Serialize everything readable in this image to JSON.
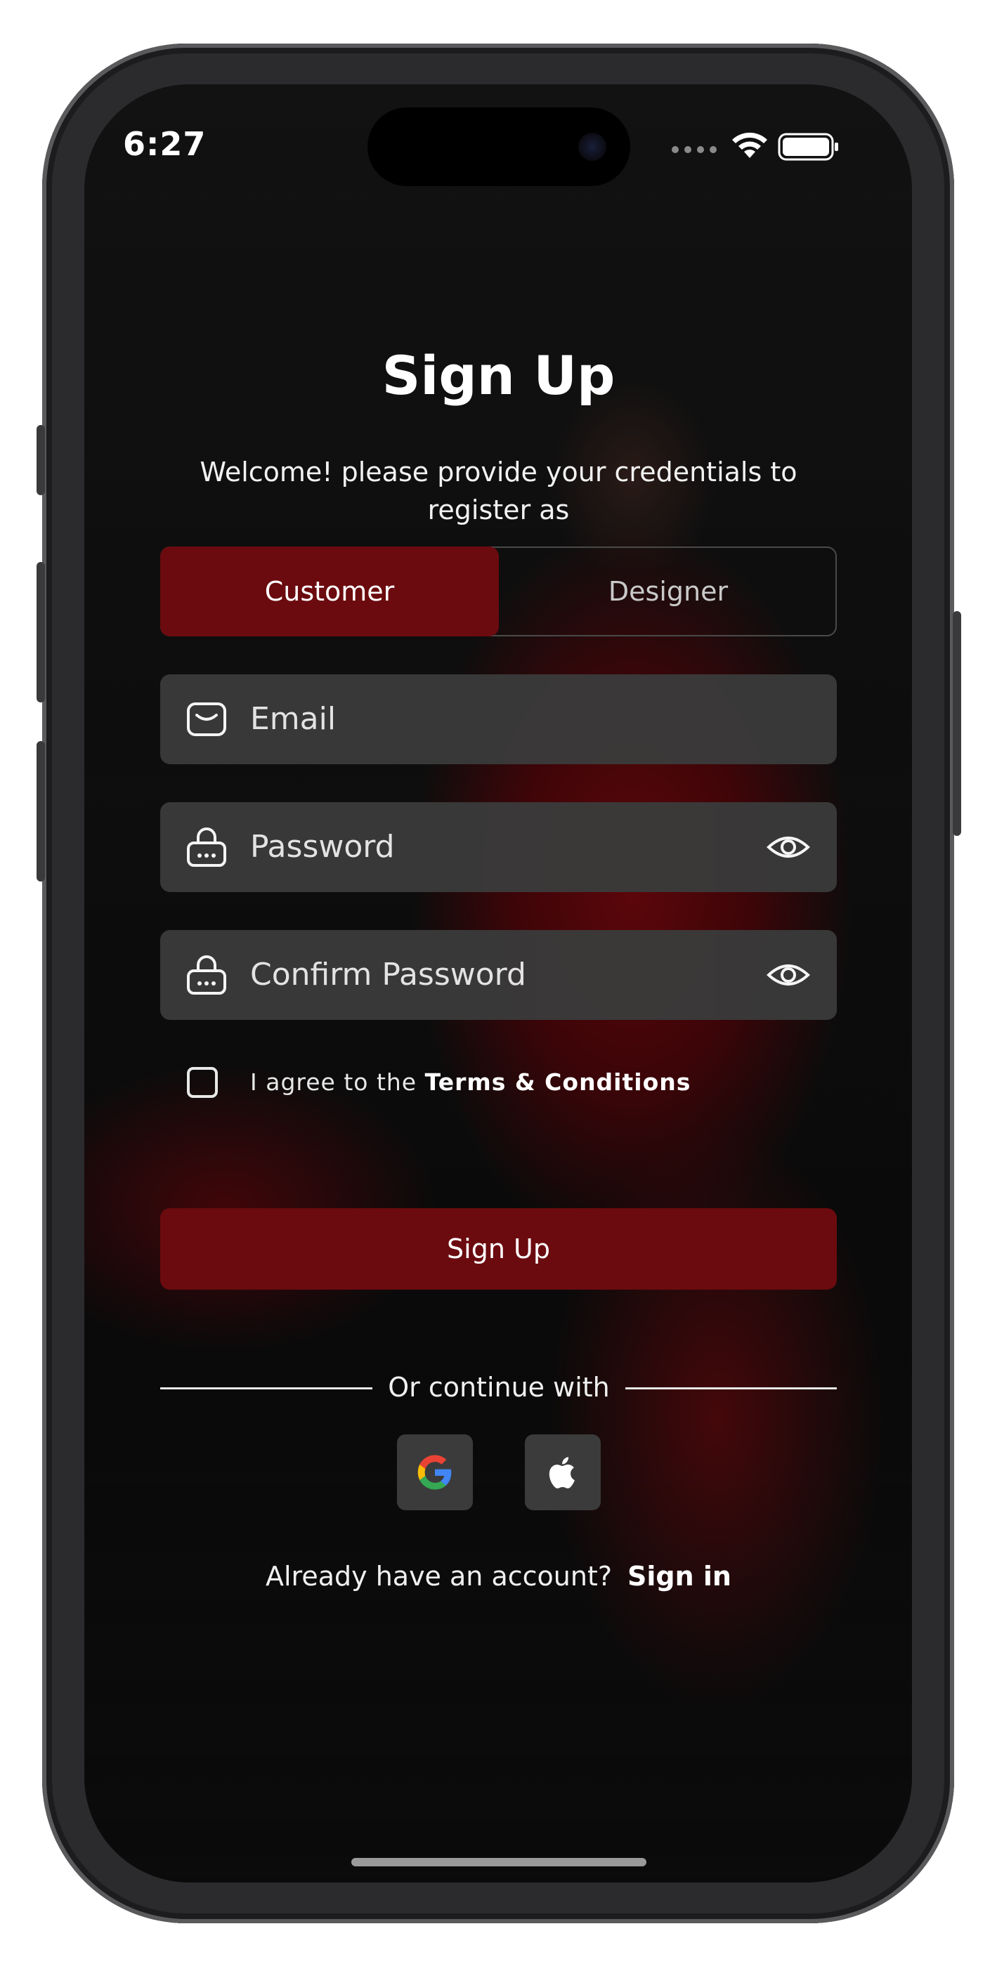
{
  "status_bar": {
    "time": "6:27",
    "icons": [
      "signal-icon",
      "wifi-icon",
      "battery-icon"
    ]
  },
  "header": {
    "title": "Sign Up",
    "subtitle_line1": "Welcome! please provide your credentials to",
    "subtitle_line2": "register as"
  },
  "role_toggle": {
    "selected": "Customer",
    "options": [
      "Customer",
      "Designer"
    ]
  },
  "form": {
    "email_placeholder": "Email",
    "password_placeholder": "Password",
    "confirm_password_placeholder": "Confirm Password",
    "agree_prefix": "I agree to the ",
    "agree_link": "Terms & Conditions",
    "agree_checked": false,
    "submit_label": "Sign Up"
  },
  "social": {
    "divider_text": "Or continue with",
    "providers": [
      "google-icon",
      "apple-icon"
    ]
  },
  "footer": {
    "prompt": "Already have an account?",
    "link": "Sign in"
  },
  "colors": {
    "accent": "#6b0b0f",
    "field_bg": "#3a3a3a",
    "text": "#ffffff"
  }
}
